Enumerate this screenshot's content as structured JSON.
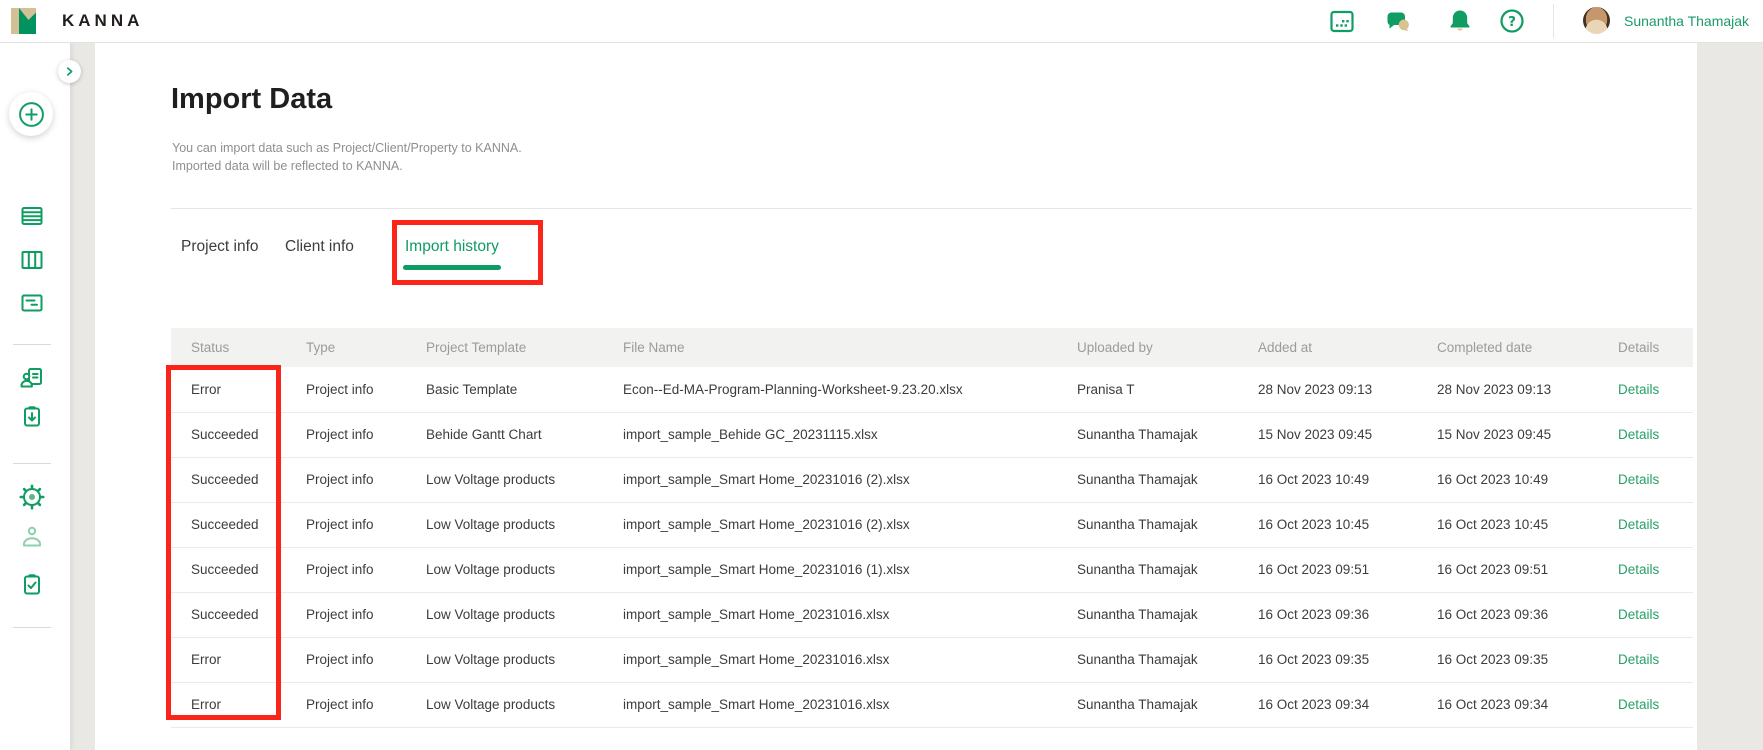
{
  "brand": {
    "name": "KANNA"
  },
  "header": {
    "user_name": "Sunantha Thamajak",
    "icons": [
      "calendar-icon",
      "chat-icon",
      "notifications-icon",
      "help-icon"
    ]
  },
  "sidebar": {
    "icons": [
      "expand-chevron-icon",
      "add-plus-icon",
      "list-view-icon",
      "board-view-icon",
      "card-view-icon",
      "client-document-icon",
      "import-download-icon",
      "settings-gear-icon",
      "account-person-icon",
      "tasks-clipboard-icon"
    ]
  },
  "page": {
    "title": "Import Data",
    "description_lines": [
      "You can import data such as Project/Client/Property to KANNA.",
      "Imported data will be reflected to KANNA."
    ]
  },
  "tabs": [
    {
      "label": "Project info",
      "active": false
    },
    {
      "label": "Client info",
      "active": false
    },
    {
      "label": "Import history",
      "active": true
    }
  ],
  "table": {
    "columns": [
      "Status",
      "Type",
      "Project Template",
      "File Name",
      "Uploaded by",
      "Added at",
      "Completed date",
      "Details"
    ],
    "rows": [
      {
        "status": "Error",
        "kind": "error",
        "type": "Project info",
        "template": "Basic Template",
        "file": "Econ--Ed-MA-Program-Planning-Worksheet-9.23.20.xlsx",
        "uploaded_by": "Pranisa T",
        "added_at": "28 Nov 2023 09:13",
        "completed": "28 Nov 2023 09:13",
        "details": "Details"
      },
      {
        "status": "Succeeded",
        "kind": "success",
        "type": "Project info",
        "template": "Behide Gantt Chart",
        "file": "import_sample_Behide GC_20231115.xlsx",
        "uploaded_by": "Sunantha Thamajak",
        "added_at": "15 Nov 2023 09:45",
        "completed": "15 Nov 2023 09:45",
        "details": "Details"
      },
      {
        "status": "Succeeded",
        "kind": "success",
        "type": "Project info",
        "template": "Low Voltage products",
        "file": "import_sample_Smart Home_20231016 (2).xlsx",
        "uploaded_by": "Sunantha Thamajak",
        "added_at": "16 Oct 2023 10:49",
        "completed": "16 Oct 2023 10:49",
        "details": "Details"
      },
      {
        "status": "Succeeded",
        "kind": "success",
        "type": "Project info",
        "template": "Low Voltage products",
        "file": "import_sample_Smart Home_20231016 (2).xlsx",
        "uploaded_by": "Sunantha Thamajak",
        "added_at": "16 Oct 2023 10:45",
        "completed": "16 Oct 2023 10:45",
        "details": "Details"
      },
      {
        "status": "Succeeded",
        "kind": "success",
        "type": "Project info",
        "template": "Low Voltage products",
        "file": "import_sample_Smart Home_20231016 (1).xlsx",
        "uploaded_by": "Sunantha Thamajak",
        "added_at": "16 Oct 2023 09:51",
        "completed": "16 Oct 2023 09:51",
        "details": "Details"
      },
      {
        "status": "Succeeded",
        "kind": "success",
        "type": "Project info",
        "template": "Low Voltage products",
        "file": "import_sample_Smart Home_20231016.xlsx",
        "uploaded_by": "Sunantha Thamajak",
        "added_at": "16 Oct 2023 09:36",
        "completed": "16 Oct 2023 09:36",
        "details": "Details"
      },
      {
        "status": "Error",
        "kind": "error",
        "type": "Project info",
        "template": "Low Voltage products",
        "file": "import_sample_Smart Home_20231016.xlsx",
        "uploaded_by": "Sunantha Thamajak",
        "added_at": "16 Oct 2023 09:35",
        "completed": "16 Oct 2023 09:35",
        "details": "Details"
      },
      {
        "status": "Error",
        "kind": "error",
        "type": "Project info",
        "template": "Low Voltage products",
        "file": "import_sample_Smart Home_20231016.xlsx",
        "uploaded_by": "Sunantha Thamajak",
        "added_at": "16 Oct 2023 09:34",
        "completed": "16 Oct 2023 09:34",
        "details": "Details"
      }
    ]
  },
  "annotations": {
    "highlight_color": "#fb2418",
    "highlighted": [
      "import-history-tab",
      "status-column"
    ]
  },
  "colors": {
    "brand_green": "#00935f",
    "brand_tan": "#d3c096",
    "error_red": "#e85549",
    "success_blue": "#3a7ac8",
    "link_green": "#27a168"
  }
}
